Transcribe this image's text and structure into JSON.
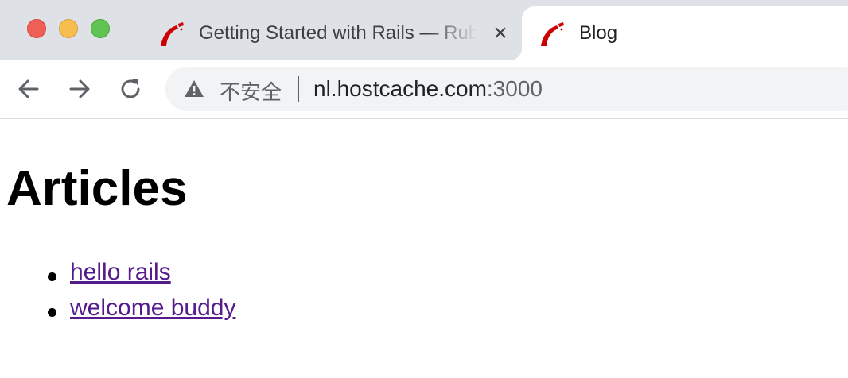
{
  "browser": {
    "tabs": [
      {
        "title": "Getting Started with Rails — Ruby on Rails Guides",
        "icon": "rails-icon"
      },
      {
        "title": "Blog",
        "icon": "rails-icon",
        "active": true
      }
    ],
    "address_bar": {
      "security_label": "不安全",
      "url_host": "nl.hostcache.com",
      "url_port": ":3000"
    },
    "colors": {
      "tab_strip": "#dee1e6",
      "rails_red": "#cc0000",
      "link_visited": "#551a8b"
    }
  },
  "page": {
    "heading": "Articles",
    "articles": [
      {
        "title": "hello rails"
      },
      {
        "title": "welcome buddy"
      }
    ]
  }
}
